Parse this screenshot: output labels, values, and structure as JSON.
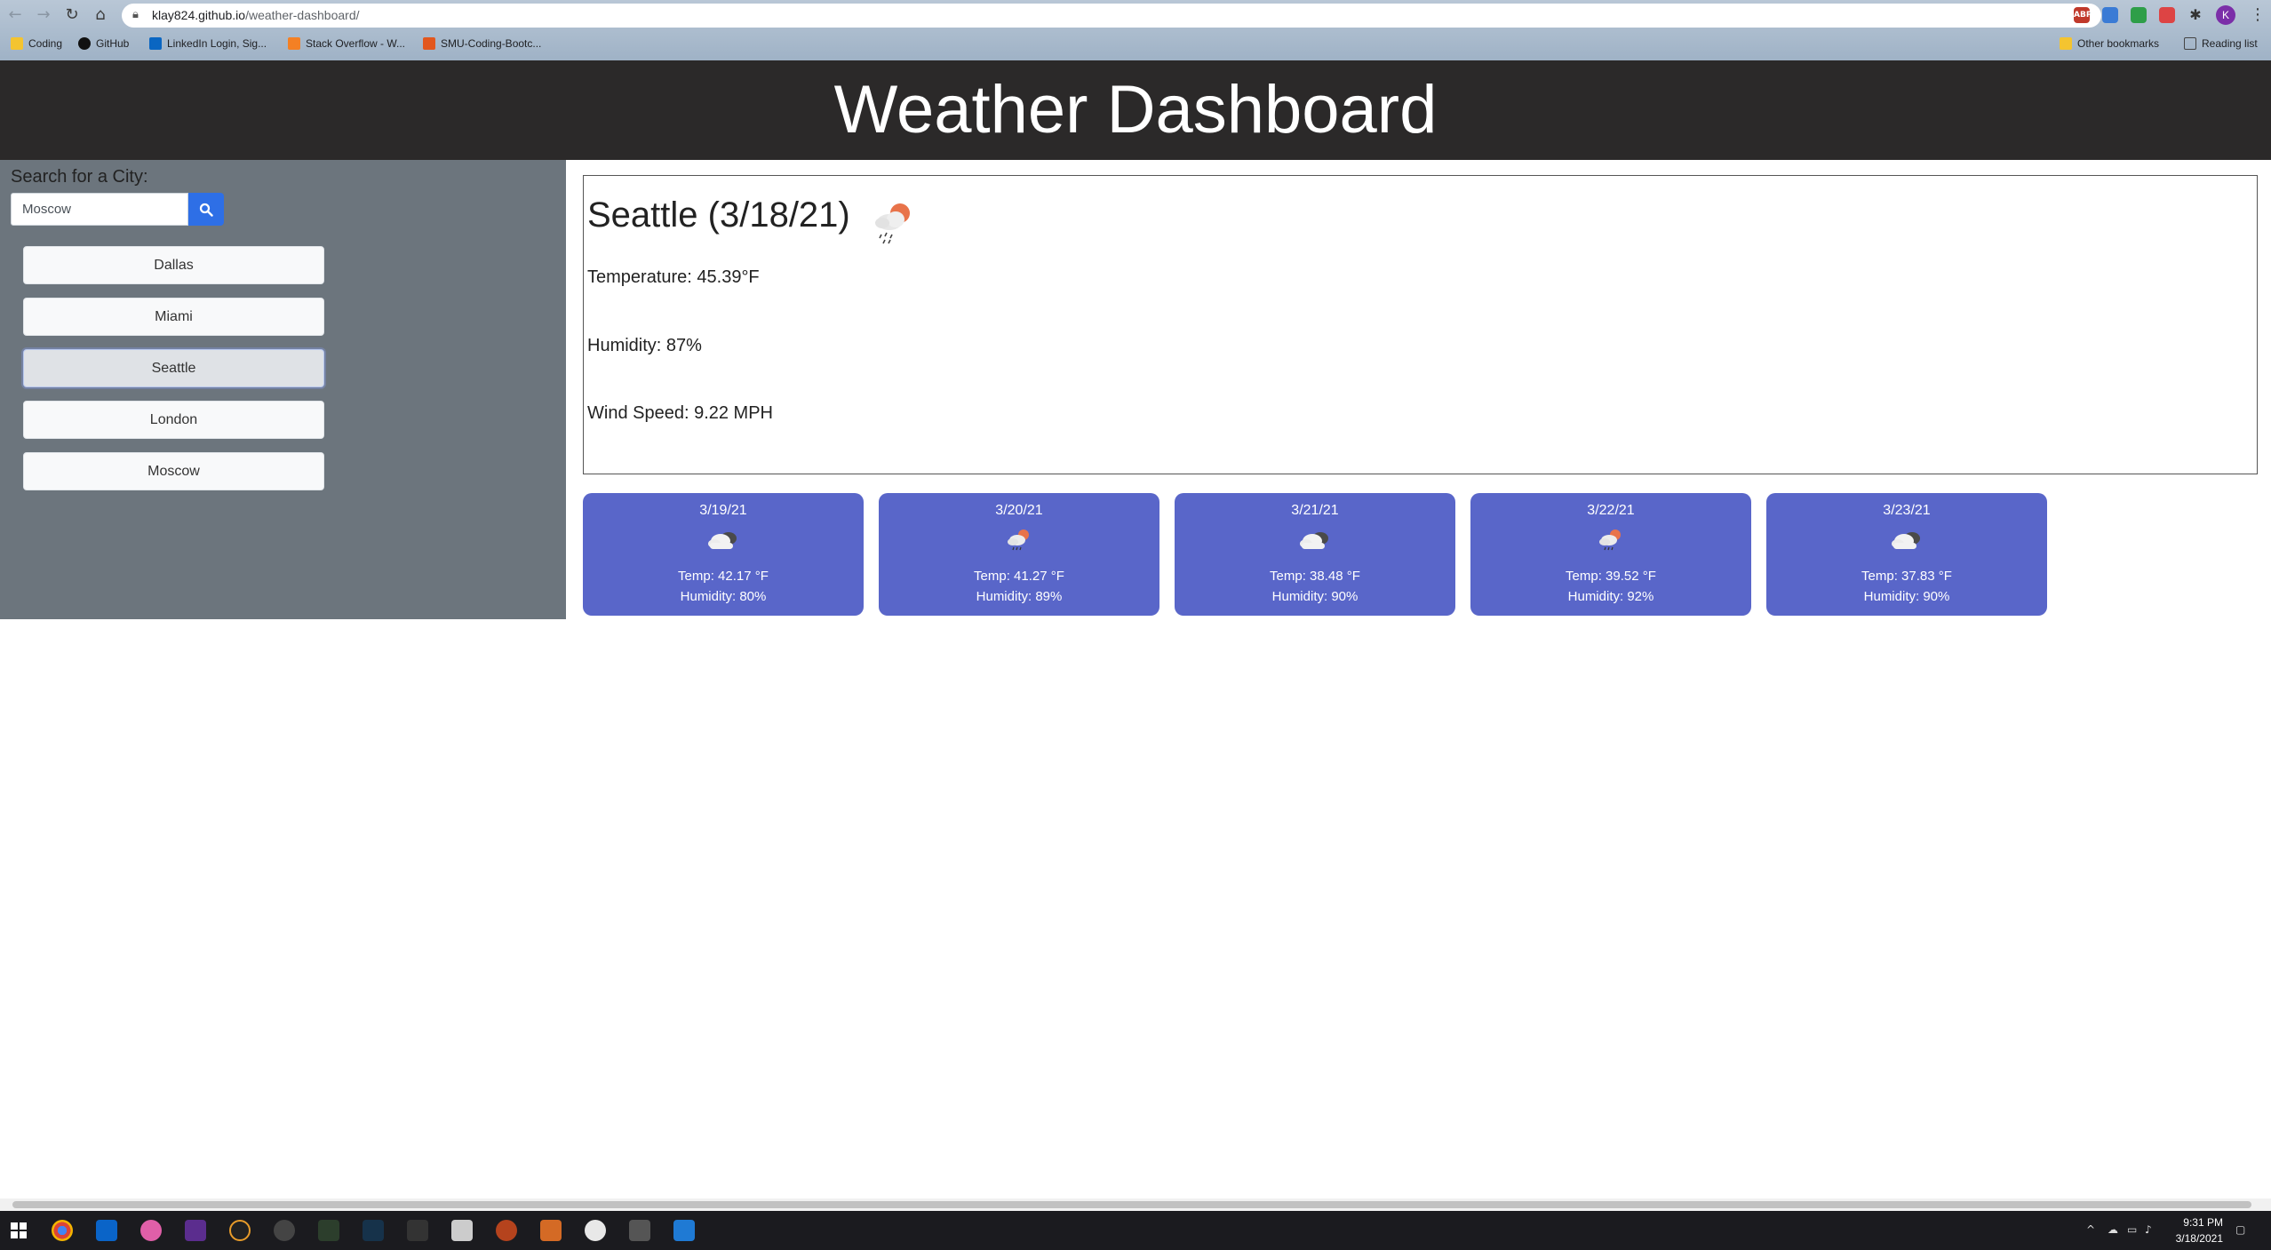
{
  "browser": {
    "url_host": "klay824.github.io",
    "url_path": "/weather-dashboard/",
    "bookmarks": [
      "Coding",
      "GitHub",
      "LinkedIn Login, Sig...",
      "Stack Overflow - W...",
      "SMU-Coding-Bootc..."
    ],
    "other_bookmarks": "Other bookmarks",
    "reading_list": "Reading list",
    "profile_initial": "K",
    "extensions": [
      {
        "name": "adblock-icon",
        "label": "ABP",
        "color": "#c0392b"
      },
      {
        "name": "cloud-extension-icon",
        "label": "",
        "color": "#3a7bd5"
      },
      {
        "name": "green-extension-icon",
        "label": "",
        "color": "#2e9e48"
      },
      {
        "name": "red-extension-icon",
        "label": "",
        "color": "#d44"
      },
      {
        "name": "puzzle-extensions-icon",
        "label": "",
        "color": "#444"
      }
    ]
  },
  "app": {
    "title": "Weather Dashboard",
    "search_label": "Search for a City:",
    "search_value": "Moscow",
    "search_icon": "search-icon",
    "cities": [
      "Dallas",
      "Miami",
      "Seattle",
      "London",
      "Moscow"
    ],
    "active_city": "Seattle",
    "current": {
      "heading": "Seattle (3/18/21)",
      "icon": "rain-sun-icon",
      "temperature": "Temperature: 45.39°F",
      "humidity": "Humidity: 87%",
      "wind": "Wind Speed: 9.22 MPH"
    },
    "forecast": [
      {
        "date": "3/19/21",
        "icon": "cloud-icon",
        "temp": "Temp: 42.17 °F",
        "humidity": "Humidity: 80%"
      },
      {
        "date": "3/20/21",
        "icon": "rain-sun-icon",
        "temp": "Temp: 41.27 °F",
        "humidity": "Humidity: 89%"
      },
      {
        "date": "3/21/21",
        "icon": "cloud-icon",
        "temp": "Temp: 38.48 °F",
        "humidity": "Humidity: 90%"
      },
      {
        "date": "3/22/21",
        "icon": "rain-sun-icon",
        "temp": "Temp: 39.52 °F",
        "humidity": "Humidity: 92%"
      },
      {
        "date": "3/23/21",
        "icon": "cloud-icon",
        "temp": "Temp: 37.83 °F",
        "humidity": "Humidity: 90%"
      }
    ],
    "colors": {
      "header_bg": "#2b2929",
      "sidebar_bg": "#6c757d",
      "card_bg": "#5966c9",
      "search_btn": "#2e6fe6"
    }
  },
  "taskbar": {
    "time": "9:31 PM",
    "date": "3/18/2021",
    "apps": [
      "start-icon",
      "chrome-icon",
      "outlook-icon",
      "itunes-icon",
      "app-icon",
      "two-icon",
      "app-icon",
      "app-icon",
      "app-icon",
      "app-icon",
      "five-icon",
      "app-icon",
      "app-icon",
      "app-icon",
      "app-icon",
      "vscode-icon"
    ]
  }
}
